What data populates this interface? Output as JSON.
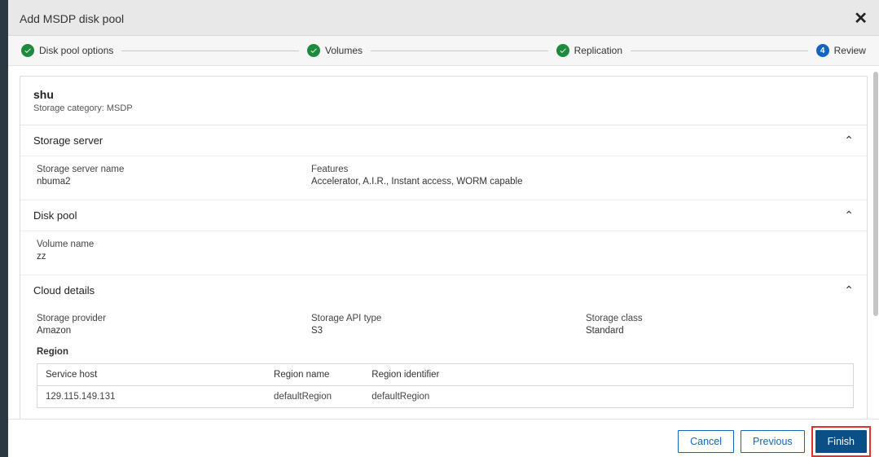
{
  "dialog": {
    "title": "Add MSDP disk pool",
    "close": "✕"
  },
  "stepper": {
    "steps": [
      {
        "label": "Disk pool options",
        "state": "done"
      },
      {
        "label": "Volumes",
        "state": "done"
      },
      {
        "label": "Replication",
        "state": "done"
      },
      {
        "label": "Review",
        "state": "current",
        "num": "4"
      }
    ]
  },
  "summary": {
    "name": "shu",
    "categoryLine": "Storage category: MSDP"
  },
  "storageServer": {
    "heading": "Storage server",
    "nameLabel": "Storage server name",
    "nameValue": "nbuma2",
    "featuresLabel": "Features",
    "featuresValue": "Accelerator, A.I.R., Instant access, WORM capable"
  },
  "diskPool": {
    "heading": "Disk pool",
    "volLabel": "Volume name",
    "volValue": "zz"
  },
  "cloud": {
    "heading": "Cloud details",
    "providerLabel": "Storage provider",
    "providerValue": "Amazon",
    "apiLabel": "Storage API type",
    "apiValue": "S3",
    "classLabel": "Storage class",
    "classValue": "Standard",
    "regionHeading": "Region",
    "table": {
      "headers": {
        "host": "Service host",
        "name": "Region name",
        "id": "Region identifier"
      },
      "row": {
        "host": "129.115.149.131",
        "name": "defaultRegion",
        "id": "defaultRegion"
      }
    }
  },
  "footer": {
    "cancel": "Cancel",
    "previous": "Previous",
    "finish": "Finish"
  }
}
